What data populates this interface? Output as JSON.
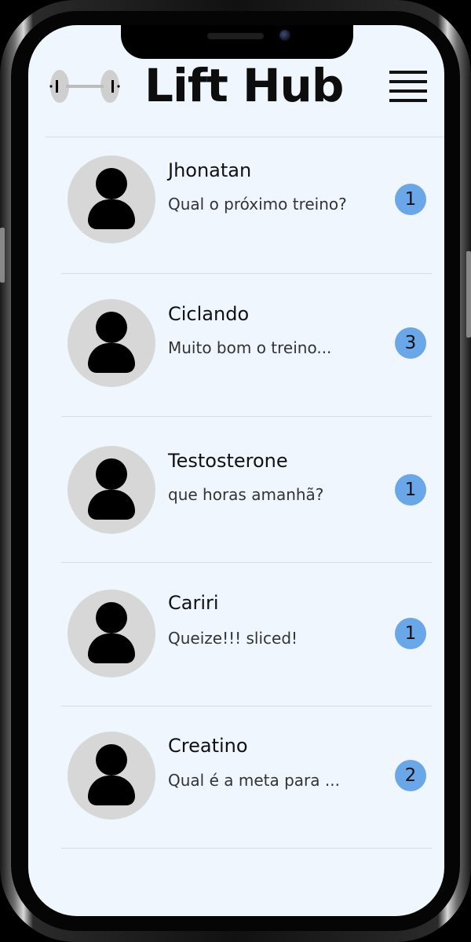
{
  "app": {
    "title": "Lift Hub",
    "logo_icon": "dumbbell-icon",
    "menu_icon": "hamburger-menu-icon"
  },
  "colors": {
    "background": "#eff6fe",
    "badge": "#6aa7e8",
    "avatar_bg": "#d7d7d7",
    "text": "#111111"
  },
  "chats": [
    {
      "name": "Jhonatan",
      "preview": "Qual o próximo treino?",
      "unread": "1"
    },
    {
      "name": "Ciclando",
      "preview": "Muito bom o treino...",
      "unread": "3"
    },
    {
      "name": "Testosterone",
      "preview": "que horas amanhã?",
      "unread": "1"
    },
    {
      "name": "Cariri",
      "preview": "Queize!!! sliced!",
      "unread": "1"
    },
    {
      "name": "Creatino",
      "preview": "Qual é a meta para ...",
      "unread": "2"
    }
  ]
}
